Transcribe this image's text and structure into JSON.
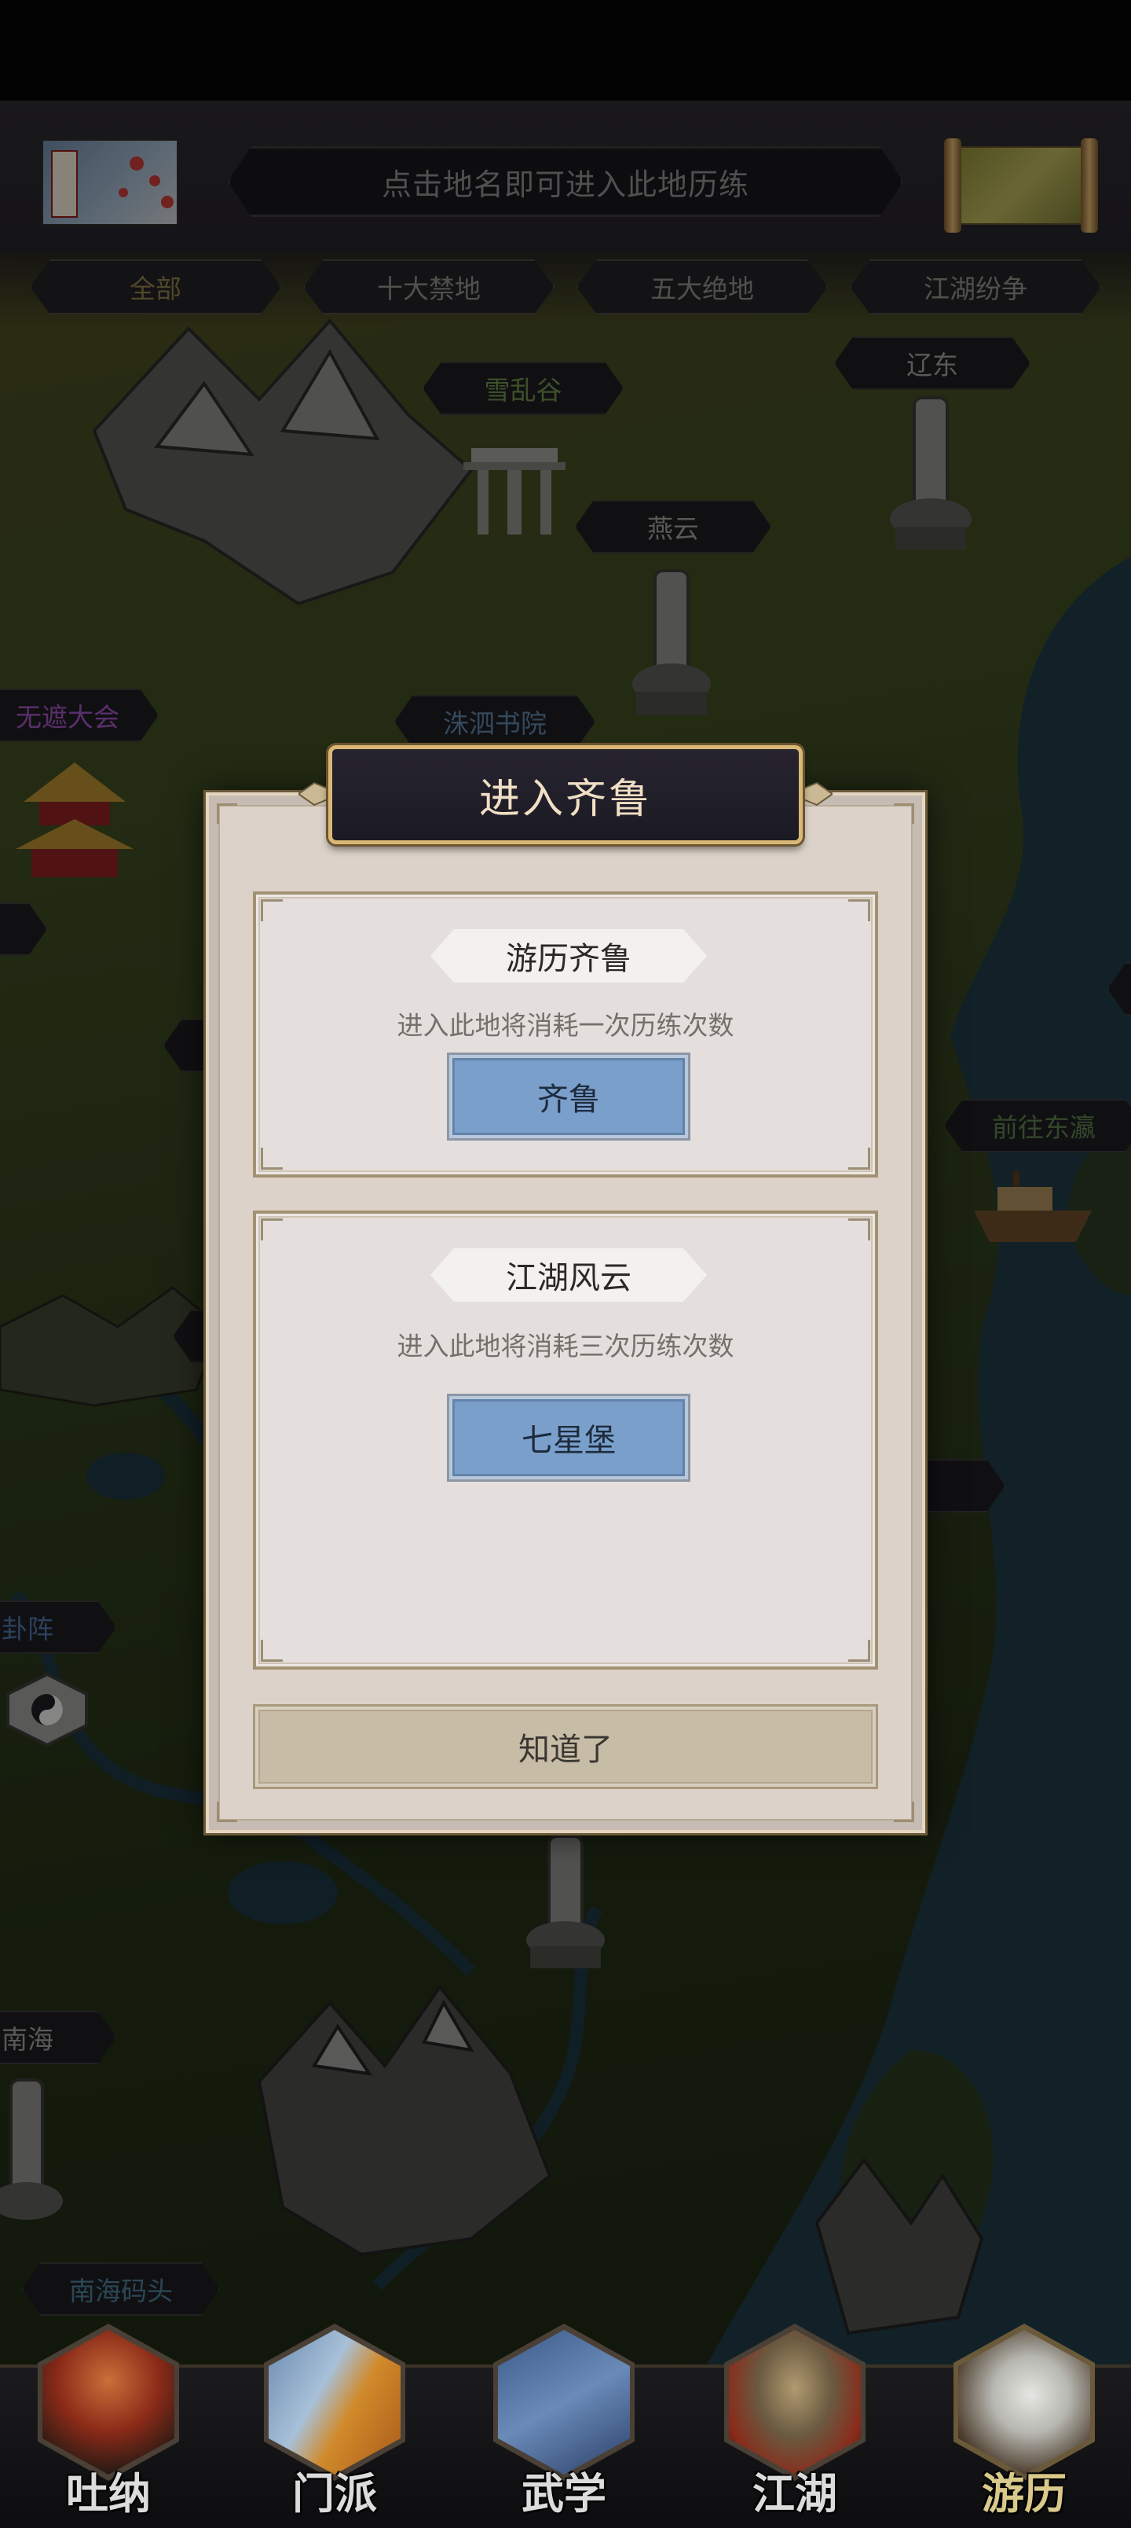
{
  "header": {
    "hint_text": "点击地名即可进入此地历练"
  },
  "filter_tabs": [
    {
      "label": "全部",
      "active": true
    },
    {
      "label": "十大禁地",
      "active": false
    },
    {
      "label": "五大绝地",
      "active": false
    },
    {
      "label": "江湖纷争",
      "active": false
    }
  ],
  "map_labels": {
    "xueluangu": "雪乱谷",
    "liaodong": "辽东",
    "yanyun": "燕云",
    "wuzhe": "无遮大会",
    "zhusi": "洙泗书院",
    "qianwang_donglai": "前往东瀛",
    "bagua": "卦阵",
    "nanhai": "南海",
    "nanhai_matou": "南海码头"
  },
  "modal": {
    "title": "进入齐鲁",
    "section1": {
      "heading": "游历齐鲁",
      "desc": "进入此地将消耗一次历练次数",
      "button": "齐鲁"
    },
    "section2": {
      "heading": "江湖风云",
      "desc": "进入此地将消耗三次历练次数",
      "button": "七星堡"
    },
    "ok_button": "知道了"
  },
  "bottom_nav": [
    {
      "label": "吐纳",
      "icon": "monk-icon"
    },
    {
      "label": "门派",
      "icon": "sect-banner-icon"
    },
    {
      "label": "武学",
      "icon": "book-icon"
    },
    {
      "label": "江湖",
      "icon": "straw-hat-icon"
    },
    {
      "label": "游历",
      "icon": "horse-icon",
      "active": true
    }
  ],
  "colors": {
    "accent_gold": "#d9b876",
    "button_blue": "#7a9fcb",
    "modal_bg": "#dcd2c9"
  }
}
